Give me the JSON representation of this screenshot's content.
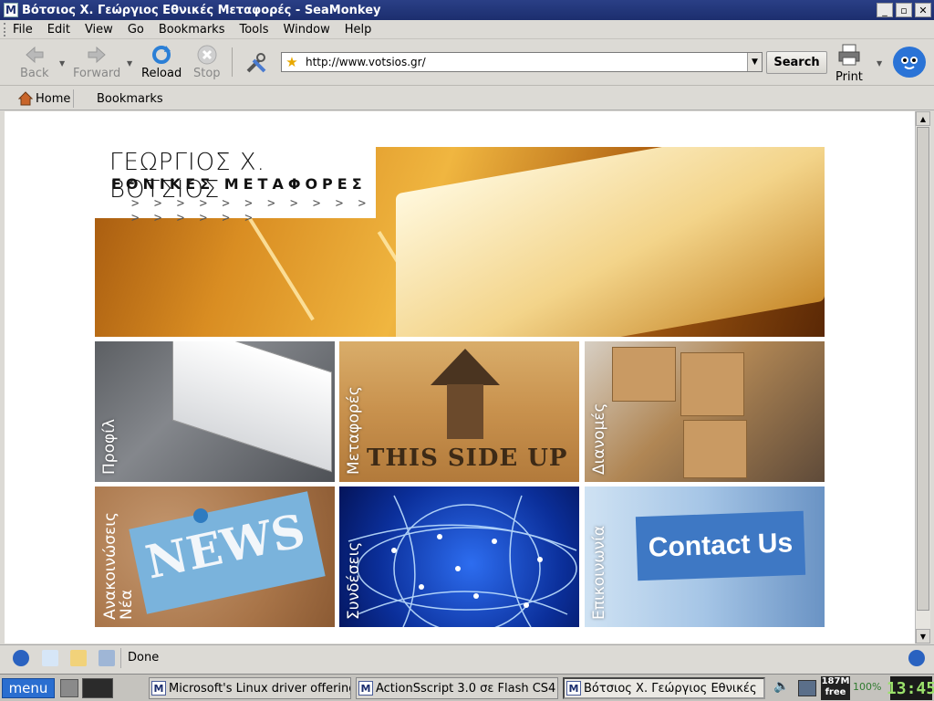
{
  "window": {
    "title": "Βότσιος Χ. Γεώργιος Εθνικές Μεταφορές - SeaMonkey",
    "app_icon": "M"
  },
  "menu": [
    "File",
    "Edit",
    "View",
    "Go",
    "Bookmarks",
    "Tools",
    "Window",
    "Help"
  ],
  "toolbar": {
    "back": "Back",
    "forward": "Forward",
    "reload": "Reload",
    "stop": "Stop",
    "url": "http://www.votsios.gr/",
    "search": "Search",
    "print": "Print"
  },
  "personal_toolbar": {
    "home": "Home",
    "bookmarks": "Bookmarks"
  },
  "page": {
    "logo_line1": "ΓΕΩΡΓΙΟΣ Χ. ΒΟΤΣΙΟΣ",
    "logo_line2": "ΕΘΝΙΚΕΣ ΜΕΤΑΦΟΡΕΣ",
    "logo_arrows": "> > > > > > > > > > > > > > > > >",
    "tiles": [
      {
        "label": "Προφίλ"
      },
      {
        "label": "Μεταφορές",
        "sign_text": "THIS SIDE UP"
      },
      {
        "label": "Διανομές"
      },
      {
        "label_line1": "Ανακοινώσεις",
        "label_line2": "Νέα",
        "card_text": "NEWS"
      },
      {
        "label": "Συνδέσεις"
      },
      {
        "label": "Επικοινωνία",
        "card_text": "Contact Us"
      }
    ]
  },
  "status": {
    "text": "Done"
  },
  "taskbar": {
    "menu": "menu",
    "tasks": [
      "Microsoft's Linux driver offering",
      "ActionSscript 3.0 σε Flash CS4",
      "Βότσιος Χ. Γεώργιος Εθνικές"
    ],
    "memory": "187M",
    "memory_free": "free",
    "battery": "100%",
    "clock": "13:45"
  }
}
